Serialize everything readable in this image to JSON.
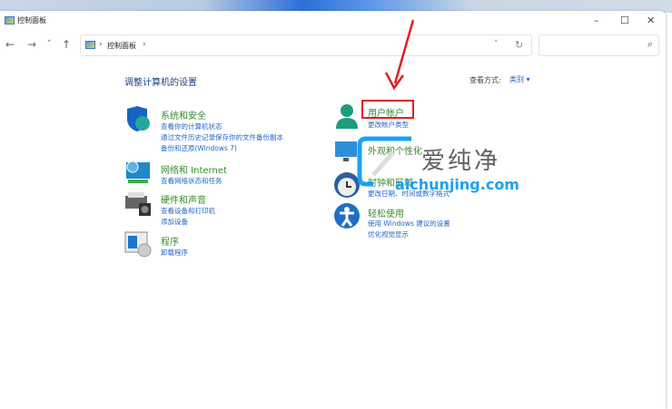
{
  "window": {
    "title": "控制面板",
    "minimize": "–",
    "maximize": "☐",
    "close": "✕"
  },
  "nav": {
    "back": "←",
    "forward": "→",
    "recent": "˅",
    "up": "↑",
    "breadcrumb": [
      "控制面板"
    ],
    "sep": "›",
    "dropdown": "˅",
    "refresh": "↻",
    "search_icon": "⌕",
    "search_placeholder": ""
  },
  "main": {
    "heading": "调整计算机的设置",
    "view_by_label": "查看方式:",
    "view_by_value": "类别",
    "view_by_caret": "▾"
  },
  "categories_left": [
    {
      "title": "系统和安全",
      "icon": "shield-icon",
      "links": [
        "查看你的计算机状态",
        "通过文件历史记录保存你的文件备份副本",
        "备份和还原(Windows 7)"
      ]
    },
    {
      "title": "网络和 Internet",
      "icon": "network-icon",
      "links": [
        "查看网络状态和任务"
      ]
    },
    {
      "title": "硬件和声音",
      "icon": "printer-icon",
      "links": [
        "查看设备和打印机",
        "添加设备"
      ]
    },
    {
      "title": "程序",
      "icon": "programs-icon",
      "links": [
        "卸载程序"
      ]
    }
  ],
  "categories_right": [
    {
      "title": "用户帐户",
      "icon": "user-icon",
      "links": [
        "更改帐户类型"
      ]
    },
    {
      "title": "外观和个性化",
      "icon": "appearance-icon",
      "links": []
    },
    {
      "title": "时钟和区域",
      "icon": "clock-icon",
      "links": [
        "更改日期、时间或数字格式"
      ]
    },
    {
      "title": "轻松使用",
      "icon": "accessibility-icon",
      "links": [
        "使用 Windows 建议的设置",
        "优化视觉显示"
      ]
    }
  ],
  "watermark": {
    "cn": "爱纯净",
    "url": "aichunjing.com"
  },
  "colors": {
    "highlight": "#e02020",
    "link": "#2266cc",
    "title": "#3a8a2e"
  }
}
